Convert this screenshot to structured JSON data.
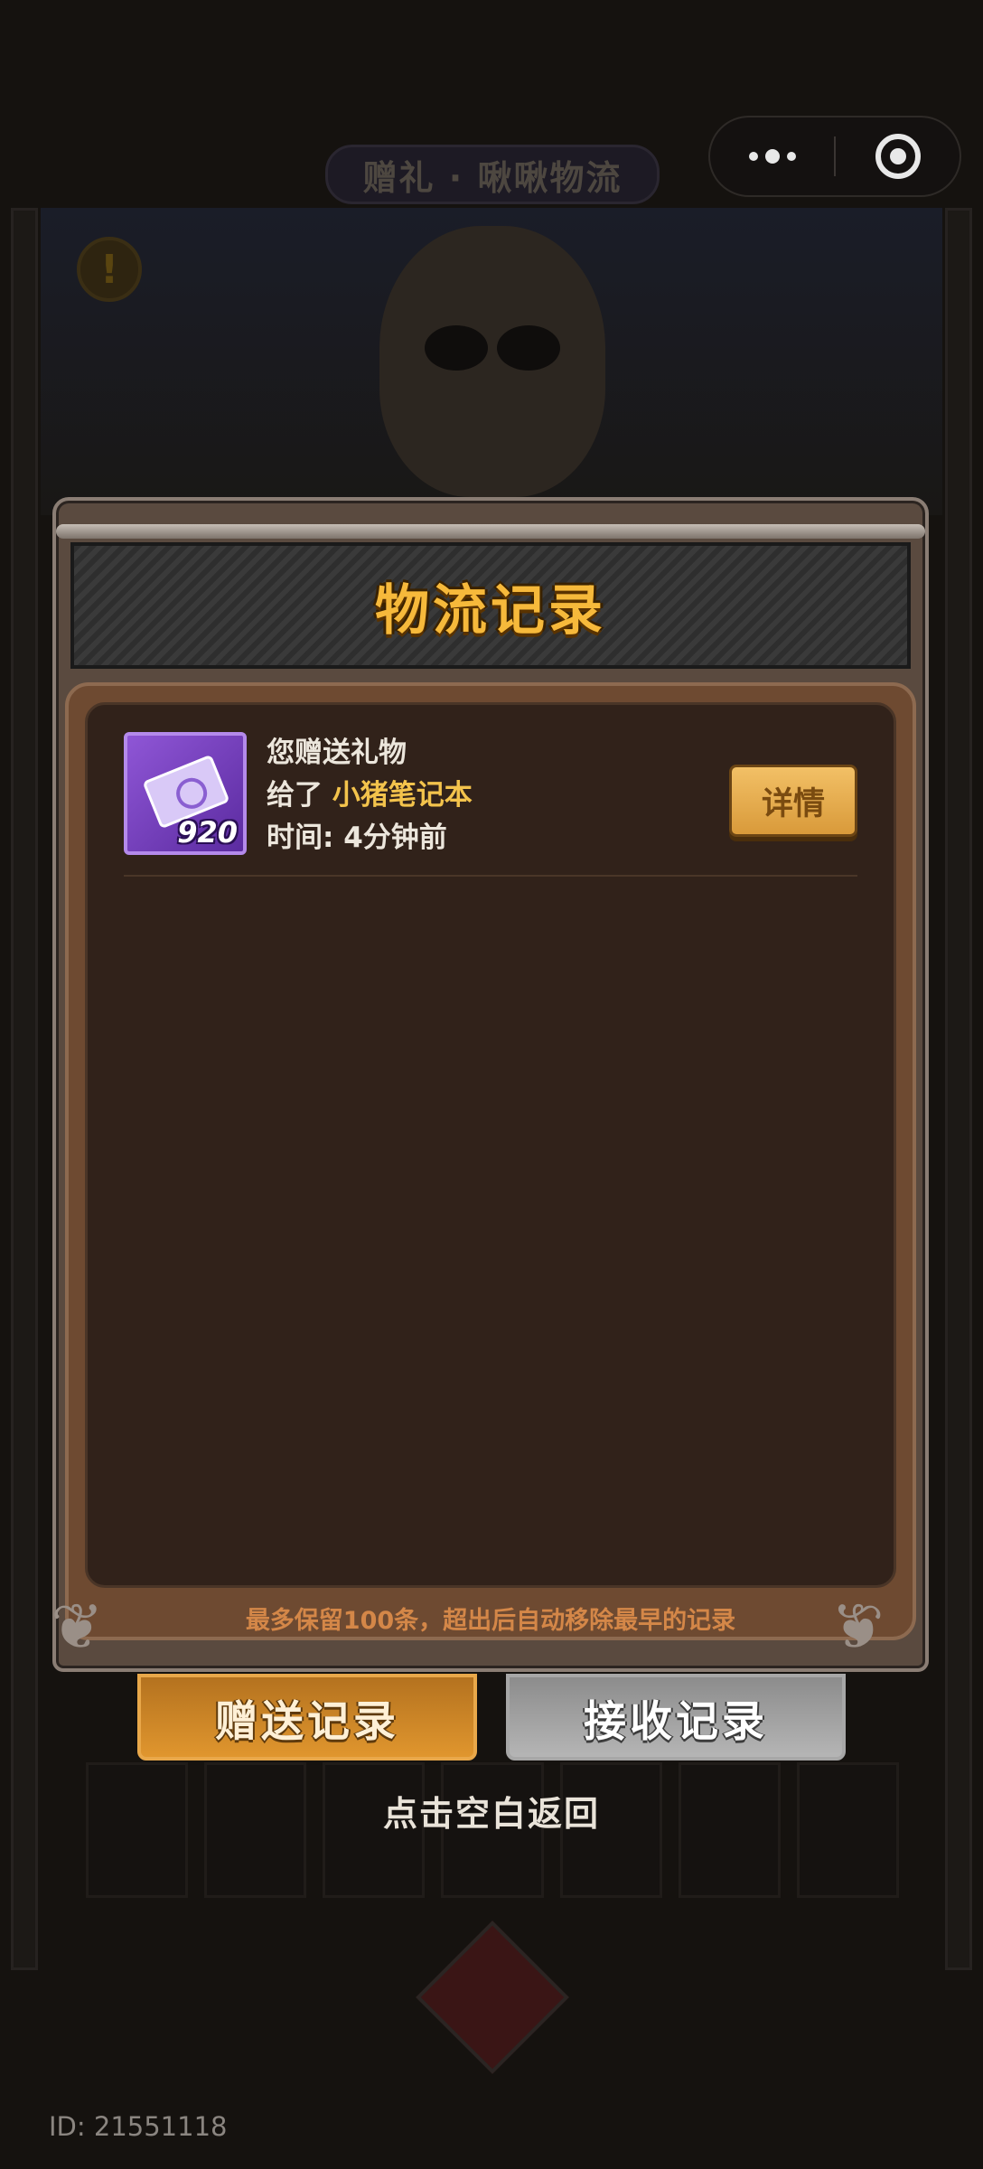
{
  "background": {
    "banner_title": "赠礼 · 啾啾物流"
  },
  "capsule": {
    "more_icon": "more-dots-icon",
    "close_icon": "target-close-icon"
  },
  "modal": {
    "title": "物流记录",
    "records": [
      {
        "line1": "您赠送礼物",
        "line2_prefix": "给了",
        "recipient": "小猪笔记本",
        "time_label": "时间:",
        "time_value": "4分钟前",
        "gift_count": "920",
        "gift_icon": "purple-ticket-icon",
        "detail_label": "详情"
      }
    ],
    "footer_note": "最多保留100条，超出后自动移除最早的记录"
  },
  "tabs": {
    "send_label": "赠送记录",
    "receive_label": "接收记录"
  },
  "back_hint": "点击空白返回",
  "user_id": "ID: 21551118",
  "colors": {
    "title_gold": "#f6b93b",
    "recipient": "#f3c34c",
    "note": "#d48748",
    "send_tab": "#e0962e",
    "receive_tab": "#b5b5b5"
  }
}
